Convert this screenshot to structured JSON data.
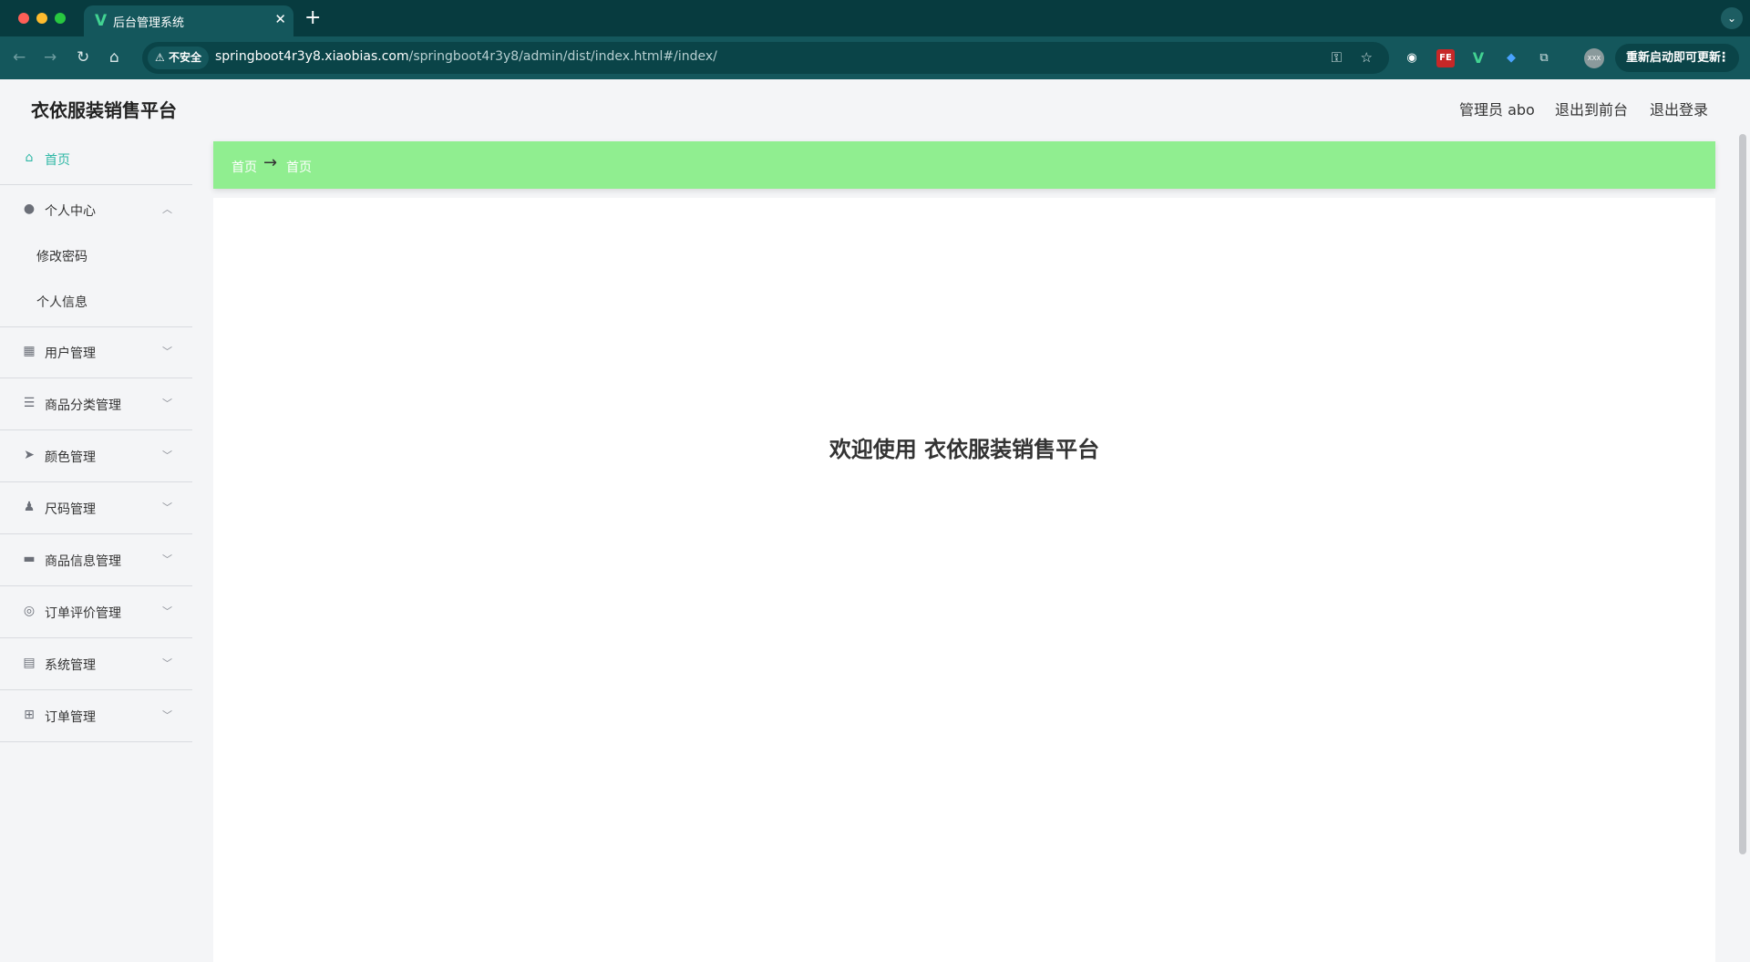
{
  "browser": {
    "tab_title": "后台管理系统",
    "tab_favicon": "V",
    "insecure_label": "不安全",
    "url_host": "springboot4r3y8.xiaobias.com",
    "url_path": "/springboot4r3y8/admin/dist/index.html#/index/",
    "relaunch_label": "重新启动即可更新",
    "ext_fe_label": "FE",
    "ext_v_label": "V",
    "avatar_label": "XXX"
  },
  "header": {
    "title": "衣依服装销售平台",
    "admin_label": "管理员 abo",
    "front_label": "退出到前台",
    "logout_label": "退出登录"
  },
  "sidebar": {
    "items": [
      {
        "label": "首页",
        "icon": "home-icon"
      },
      {
        "label": "个人中心",
        "icon": "user-icon"
      },
      {
        "label": "用户管理",
        "icon": "stamp-icon"
      },
      {
        "label": "商品分类管理",
        "icon": "list-icon"
      },
      {
        "label": "颜色管理",
        "icon": "send-icon"
      },
      {
        "label": "尺码管理",
        "icon": "person-icon"
      },
      {
        "label": "商品信息管理",
        "icon": "chat-icon"
      },
      {
        "label": "订单评价管理",
        "icon": "compass-icon"
      },
      {
        "label": "系统管理",
        "icon": "clipboard-icon"
      },
      {
        "label": "订单管理",
        "icon": "grid-icon"
      }
    ],
    "personal_sub": [
      "修改密码",
      "个人信息"
    ]
  },
  "breadcrumb": {
    "first": "首页",
    "separator": "→",
    "second": "首页"
  },
  "main": {
    "welcome": "欢迎使用 衣依服装销售平台"
  },
  "colors": {
    "chrome_bg": "#073b3f",
    "toolbar_bg": "#14575c",
    "breadcrumb_bg": "#90ee90",
    "active_menu": "#2fb8a6"
  }
}
